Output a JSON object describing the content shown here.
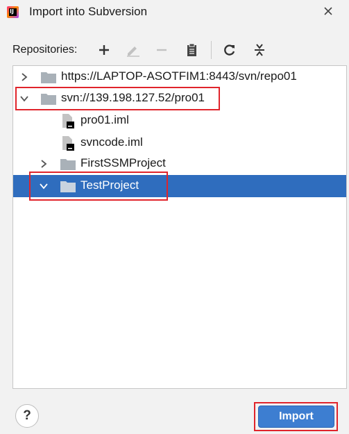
{
  "window": {
    "title": "Import into Subversion",
    "app_icon_text": "IJ"
  },
  "toolbar": {
    "label": "Repositories:",
    "buttons": [
      {
        "icon": "plus-icon",
        "enabled": true
      },
      {
        "icon": "edit-pencil-icon",
        "enabled": false
      },
      {
        "icon": "minus-icon",
        "enabled": false
      },
      {
        "icon": "clipboard-icon",
        "enabled": true
      },
      {
        "icon": "refresh-icon",
        "enabled": true
      },
      {
        "icon": "collapse-all-icon",
        "enabled": true
      }
    ]
  },
  "tree": {
    "items": [
      {
        "label": "https://LAPTOP-ASOTFIM1:8443/svn/repo01",
        "type": "folder",
        "expanded": false,
        "selected": false
      },
      {
        "label": "svn://139.198.127.52/pro01",
        "type": "folder",
        "expanded": true,
        "selected": false
      },
      {
        "label": "pro01.iml",
        "type": "file",
        "selected": false
      },
      {
        "label": "svncode.iml",
        "type": "file",
        "selected": false
      },
      {
        "label": "FirstSSMProject",
        "type": "folder",
        "expanded": false,
        "selected": false
      },
      {
        "label": "TestProject",
        "type": "folder",
        "expanded": true,
        "selected": true
      }
    ]
  },
  "footer": {
    "help_label": "?",
    "import_label": "Import"
  },
  "colors": {
    "selection": "#2f6dbe",
    "primary_button": "#3d7ed1",
    "annotation_border": "#e0242b",
    "folder_icon": "#a9b1b8"
  }
}
